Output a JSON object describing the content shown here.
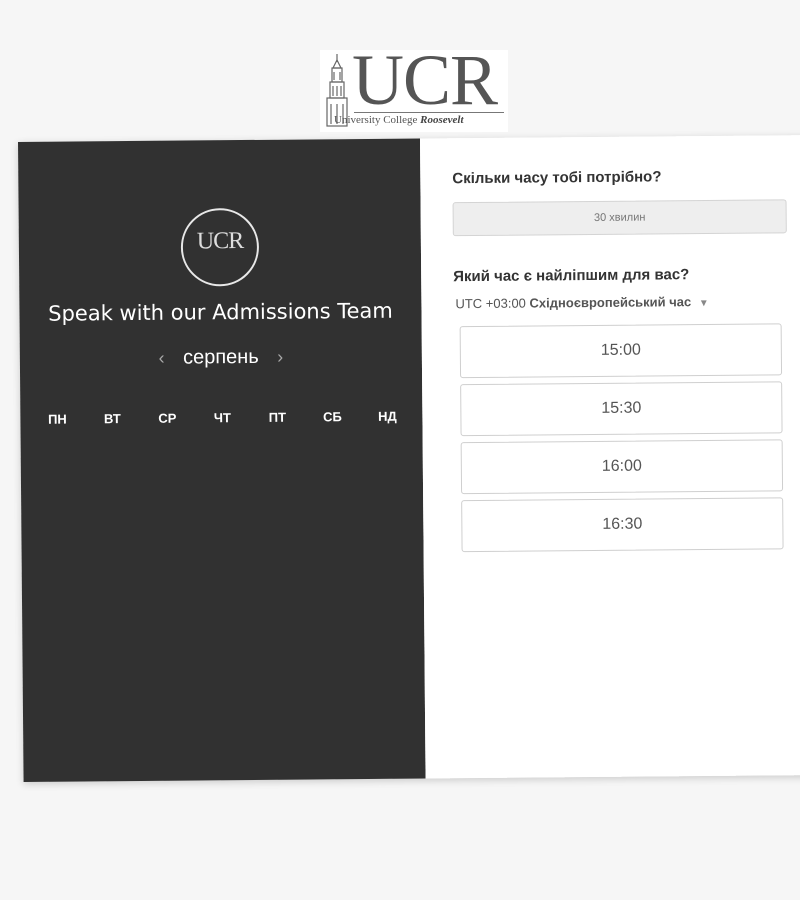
{
  "logo": {
    "letters": "UCR",
    "subtitle_plain": "University College ",
    "subtitle_italic": "Roosevelt"
  },
  "left_panel": {
    "title": "Speak with our Admissions Team",
    "month": "серпень",
    "prev_arrow": "‹",
    "next_arrow": "›",
    "weekdays": [
      "ПН",
      "ВТ",
      "СР",
      "ЧТ",
      "ПТ",
      "СБ",
      "НД"
    ]
  },
  "right_panel": {
    "duration_question": "Скільки часу тобі потрібно?",
    "duration_value": "30 хвилин",
    "time_question": "Який час є найліпшим для вас?",
    "timezone_offset": "UTC +03:00",
    "timezone_name": "Східноєвропейський час",
    "time_slots": [
      "15:00",
      "15:30",
      "16:00",
      "16:30"
    ]
  },
  "colors": {
    "left_panel_bg": "#313131",
    "page_bg": "#f6f6f6"
  }
}
